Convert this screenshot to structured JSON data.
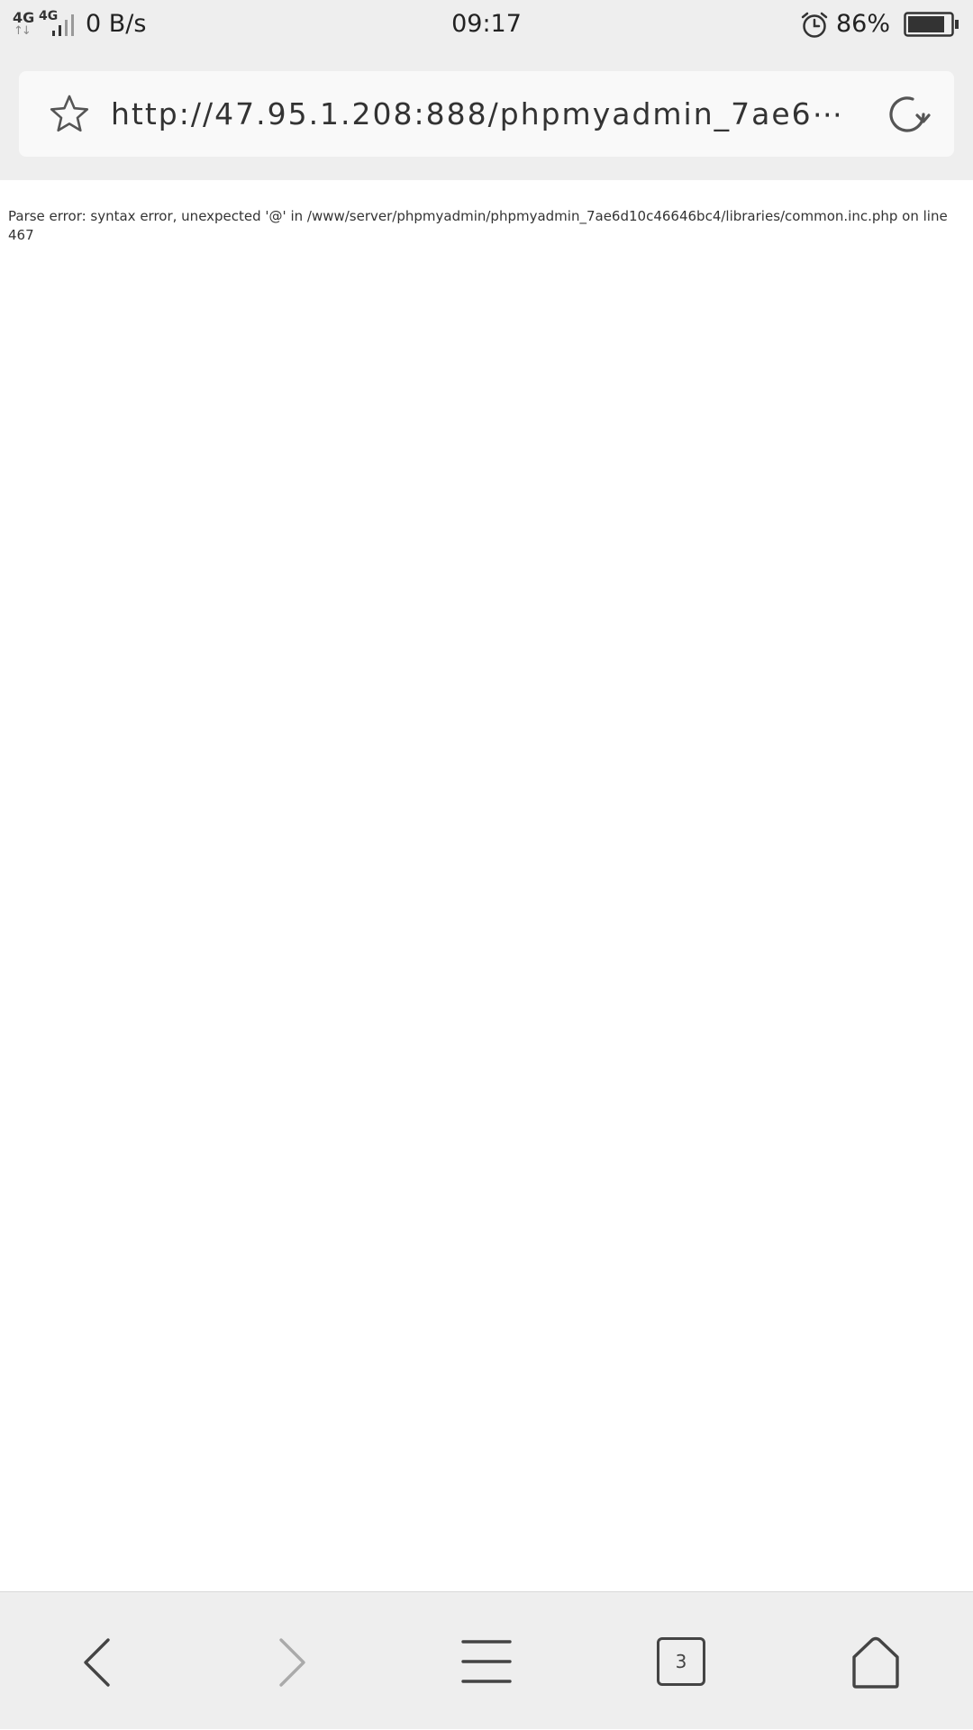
{
  "status_bar": {
    "sim1_label": "4G",
    "sim2_label": "4G",
    "net_speed": "0 B/s",
    "time": "09:17",
    "battery_percent": "86%",
    "battery_level": 0.86,
    "icons": [
      "signal-icon",
      "alarm-icon",
      "battery-icon"
    ]
  },
  "browser": {
    "url": "http://47.95.1.208:888/phpmyadmin_7ae6⋯",
    "icons": [
      "star-icon",
      "reload-icon"
    ]
  },
  "page": {
    "error_message": "Parse error: syntax error, unexpected '@' in /www/server/phpmyadmin/phpmyadmin_7ae6d10c46646bc4/libraries/common.inc.php on line 467"
  },
  "bottom_nav": {
    "tab_count": "3",
    "icons": [
      "back-icon",
      "forward-icon",
      "menu-icon",
      "tabs-icon",
      "home-icon"
    ]
  },
  "colors": {
    "chrome_bg": "#eeeeee",
    "url_bar_bg": "#f9f9f9",
    "icon_color": "#444444",
    "disabled_icon_color": "#aaaaaa",
    "text_color": "#333333"
  }
}
